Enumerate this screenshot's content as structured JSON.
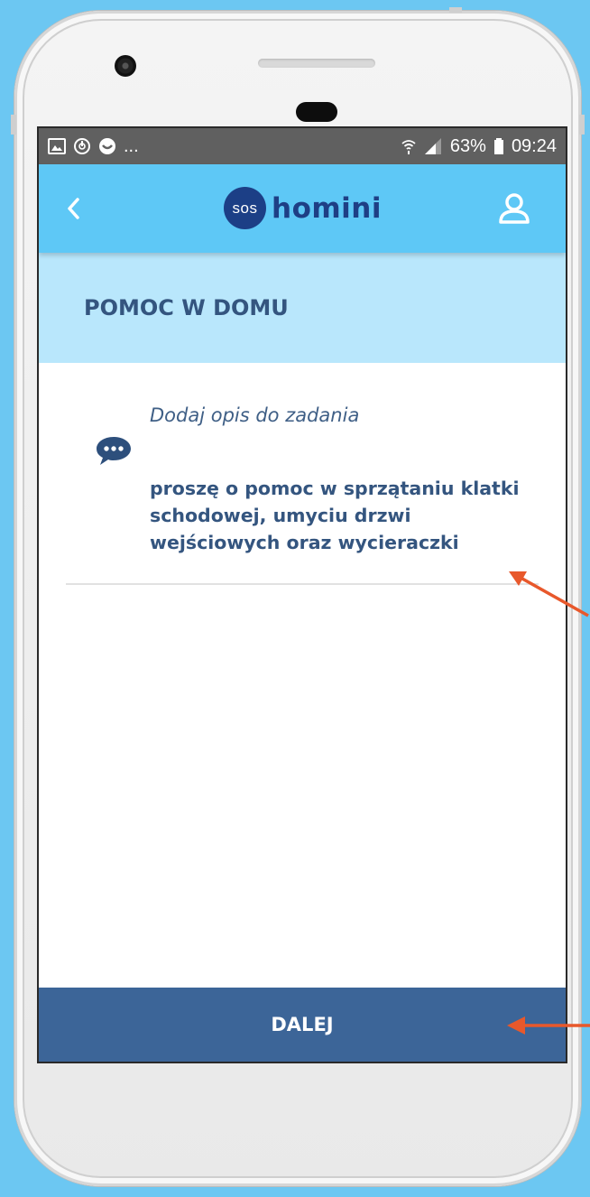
{
  "status_bar": {
    "battery": "63%",
    "time": "09:24",
    "more": "..."
  },
  "app_bar": {
    "logo_badge": "sos",
    "logo_name": "homini"
  },
  "section": {
    "title": "POMOC W DOMU"
  },
  "description_field": {
    "label": "Dodaj opis do zadania",
    "value": "proszę o pomoc w sprzątaniu klatki schodowej, umyciu drzwi wejściowych oraz wycieraczki"
  },
  "actions": {
    "next_label": "DALEJ"
  },
  "colors": {
    "background": "#6cc7f2",
    "app_bar": "#5ec8f6",
    "section_header": "#b9e7fc",
    "brand_dark": "#1c3f86",
    "text_primary": "#34557f",
    "button": "#3c6598",
    "annotation_arrow": "#e8582b"
  },
  "icons": {
    "back": "chevron-left-icon",
    "profile": "user-icon",
    "description": "speech-bubble-icon"
  }
}
